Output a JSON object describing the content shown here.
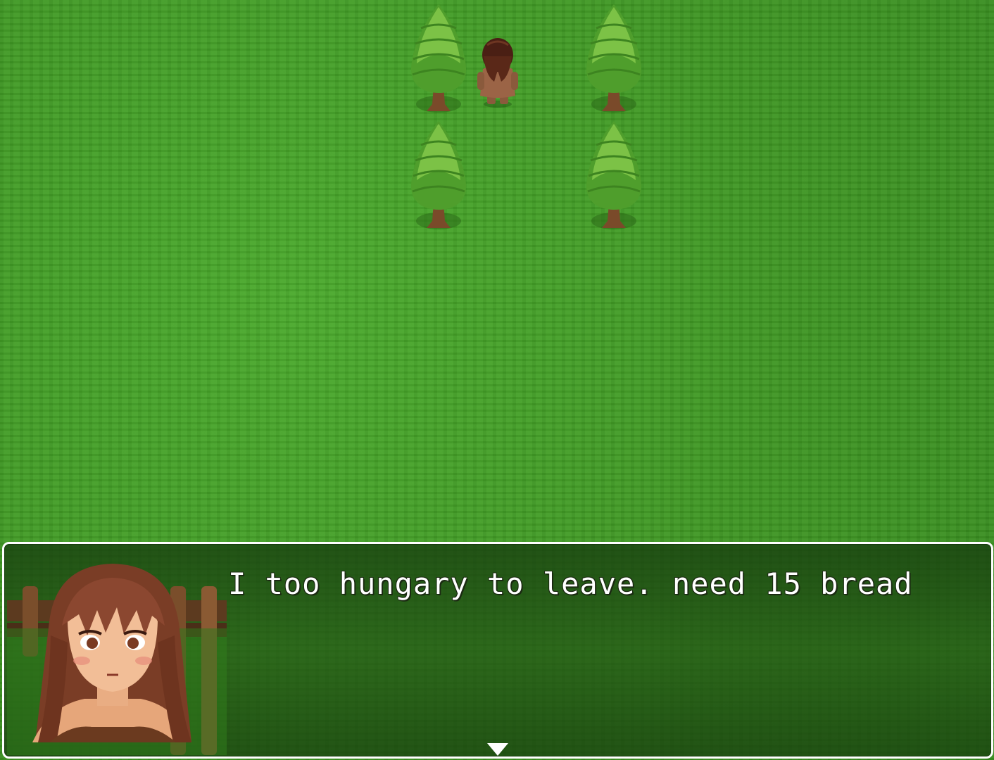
{
  "scene": {
    "ground": "grass-field",
    "colors": {
      "grass": "#3f9a23",
      "tree_foliage": "#5aa934",
      "tree_trunk": "#7a4a2a",
      "dialog_border": "#ffffff",
      "dialog_text": "#ffffff"
    },
    "trees": 4,
    "player_character": "brown-haired-character-facing-away"
  },
  "dialog": {
    "message": "I too hungary to leave. need 15 bread",
    "speaker_portrait": "brown-haired-girl-portrait",
    "continue_indicator": "down-triangle-icon"
  }
}
